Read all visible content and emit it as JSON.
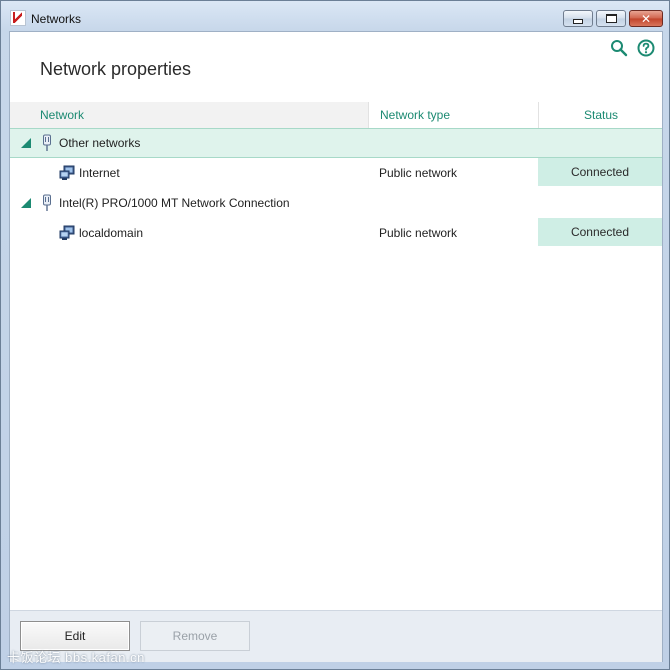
{
  "window": {
    "title": "Networks",
    "controls": {
      "minimize_icon": "minimize-icon",
      "maximize_icon": "maximize-icon",
      "close_label": "✕"
    }
  },
  "toolbar": {
    "search_icon": "search-icon",
    "help_icon": "help-icon"
  },
  "page": {
    "title": "Network properties"
  },
  "table": {
    "columns": [
      "Network",
      "Network type",
      "Status"
    ],
    "groups": [
      {
        "name": "Other networks",
        "expanded": true,
        "selected": true,
        "children": [
          {
            "name": "Internet",
            "type": "Public network",
            "status": "Connected"
          }
        ]
      },
      {
        "name": "Intel(R) PRO/1000 MT Network Connection",
        "expanded": true,
        "selected": false,
        "children": [
          {
            "name": "localdomain",
            "type": "Public network",
            "status": "Connected"
          }
        ]
      }
    ]
  },
  "buttons": {
    "edit": "Edit",
    "remove": "Remove"
  },
  "watermark": "卡饭论坛 bbs.kafan.cn",
  "colors": {
    "accent": "#1c8a72",
    "status_bg": "#cfeee5",
    "selected_row": "#dff3ec"
  }
}
